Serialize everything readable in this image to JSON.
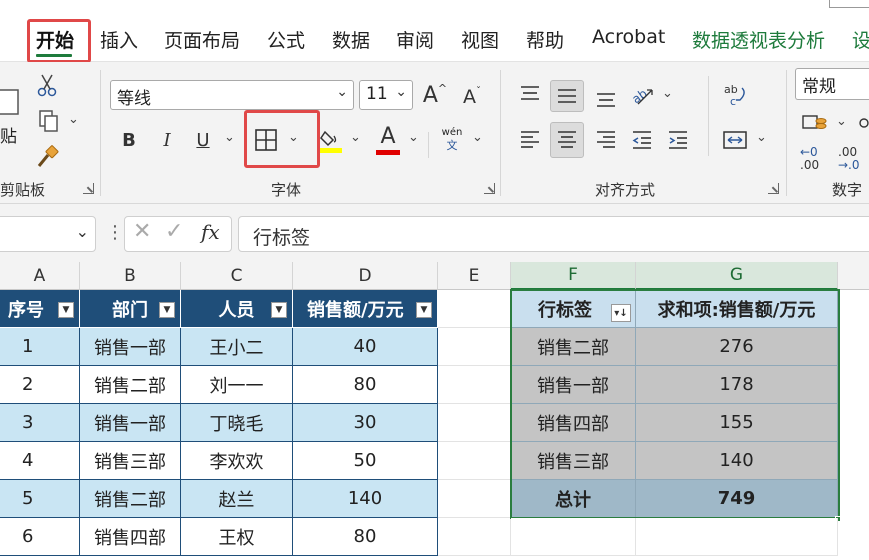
{
  "tabs": [
    {
      "label": "开始",
      "active": true
    },
    {
      "label": "插入"
    },
    {
      "label": "页面布局"
    },
    {
      "label": "公式"
    },
    {
      "label": "数据"
    },
    {
      "label": "审阅"
    },
    {
      "label": "视图"
    },
    {
      "label": "帮助"
    },
    {
      "label": "Acrobat"
    },
    {
      "label": "数据透视表分析",
      "contextual": true
    },
    {
      "label": "设",
      "contextual": true
    }
  ],
  "ribbon": {
    "clipboard": {
      "paste_label": "贴",
      "group_label": "剪贴板"
    },
    "font": {
      "font_name": "等线",
      "font_size": "11",
      "bold": "B",
      "italic": "I",
      "underline": "U",
      "grow_glyph": "A",
      "shrink_glyph": "A",
      "font_color_glyph": "A",
      "phonetic_top": "wén",
      "phonetic_bottom": "文",
      "group_label": "字体",
      "fill_color": "#ffff00",
      "font_color": "#e00000"
    },
    "alignment": {
      "group_label": "对齐方式"
    },
    "number": {
      "format": "常规",
      "group_label": "数字",
      "inc_decimal": ".00",
      "dec_decimal": ".00"
    }
  },
  "formula_bar": {
    "fx": "fx",
    "content": "行标签"
  },
  "grid": {
    "columns": [
      "A",
      "B",
      "C",
      "D",
      "E",
      "F",
      "G"
    ],
    "table": {
      "headers": [
        "序号",
        "部门",
        "人员",
        "销售额/万元"
      ],
      "rows": [
        [
          "1",
          "销售一部",
          "王小二",
          "40"
        ],
        [
          "2",
          "销售二部",
          "刘一一",
          "80"
        ],
        [
          "3",
          "销售一部",
          "丁晓毛",
          "30"
        ],
        [
          "4",
          "销售三部",
          "李欢欢",
          "50"
        ],
        [
          "5",
          "销售二部",
          "赵兰",
          "140"
        ],
        [
          "6",
          "销售四部",
          "王权",
          "80"
        ]
      ]
    },
    "pivot": {
      "headers": [
        "行标签",
        "求和项:销售额/万元"
      ],
      "rows": [
        [
          "销售二部",
          "276"
        ],
        [
          "销售一部",
          "178"
        ],
        [
          "销售四部",
          "155"
        ],
        [
          "销售三部",
          "140"
        ]
      ],
      "total": [
        "总计",
        "749"
      ]
    }
  }
}
